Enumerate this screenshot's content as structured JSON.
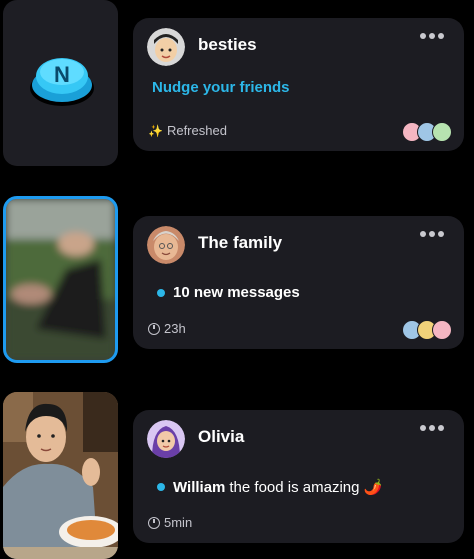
{
  "threads": [
    {
      "title": "besties",
      "status_text": "Nudge your friends",
      "footer_icon": "sparkles-icon",
      "footer_text": "Refreshed",
      "accent": "#2cb7e8",
      "thumb_logo_letter": "N"
    },
    {
      "title": "The family",
      "message": "10 new messages",
      "footer_icon": "clock-icon",
      "footer_text": "23h"
    },
    {
      "title": "Olivia",
      "message_sender": "William",
      "message_text": "the food is amazing 🌶️",
      "footer_icon": "clock-icon",
      "footer_text": "5min"
    }
  ],
  "more_icon": "more-horizontal-icon",
  "unread_dot_color": "#2cb7e8",
  "selected_border_color": "#1e9bf0"
}
